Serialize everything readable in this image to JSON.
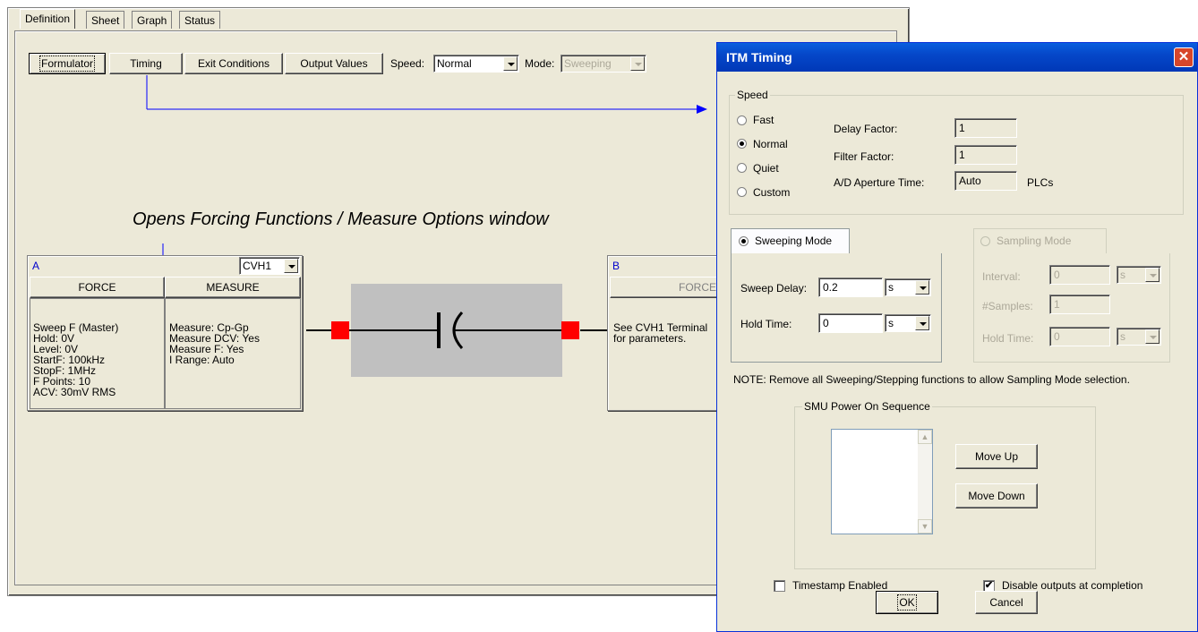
{
  "main": {
    "tabs": [
      "Definition",
      "Sheet",
      "Graph",
      "Status"
    ],
    "toolbar": {
      "formulator": "Formulator",
      "timing": "Timing",
      "exit_conditions": "Exit Conditions",
      "output_values": "Output Values",
      "speed_label": "Speed:",
      "speed_value": "Normal",
      "mode_label": "Mode:",
      "mode_value": "Sweeping"
    },
    "annotation": "Opens Forcing Functions / Measure Options window",
    "terminal_a": {
      "letter": "A",
      "select": "CVH1",
      "force_header": "FORCE",
      "measure_header": "MEASURE",
      "force_lines": [
        "Sweep F (Master)",
        "Hold: 0V",
        "Level: 0V",
        "StartF: 100kHz",
        "StopF: 1MHz",
        "F Points: 10",
        "ACV: 30mV RMS"
      ],
      "measure_lines": [
        "Measure: Cp-Gp",
        "Measure DCV: Yes",
        "Measure F: Yes",
        "I Range: Auto"
      ]
    },
    "terminal_b": {
      "letter": "B",
      "force_header": "FORCE",
      "lines": [
        "See CVH1 Terminal",
        "for parameters."
      ]
    },
    "colors": {
      "accent": "#0000ff",
      "terminal": "#ff0000",
      "device": "#c0c0c0"
    }
  },
  "dialog": {
    "title": "ITM Timing",
    "speed_group": "Speed",
    "speed_options": [
      "Fast",
      "Normal",
      "Quiet",
      "Custom"
    ],
    "speed_selected": "Normal",
    "delay_factor_label": "Delay Factor:",
    "delay_factor": "1",
    "filter_factor_label": "Filter Factor:",
    "filter_factor": "1",
    "ad_label": "A/D Aperture Time:",
    "ad_value": "Auto",
    "ad_unit": "PLCs",
    "sweeping_mode": "Sweeping Mode",
    "sweep_delay_label": "Sweep Delay:",
    "sweep_delay": "0.2",
    "sweep_delay_unit": "s",
    "hold_time_label": "Hold Time:",
    "hold_time": "0",
    "hold_time_unit": "s",
    "sampling_mode": "Sampling Mode",
    "interval_label": "Interval:",
    "interval": "0",
    "interval_unit": "s",
    "samples_label": "#Samples:",
    "samples": "1",
    "s_hold_label": "Hold Time:",
    "s_hold": "0",
    "s_hold_unit": "s",
    "note": "NOTE: Remove all Sweeping/Stepping functions to allow Sampling Mode selection.",
    "smu_group": "SMU Power On Sequence",
    "move_up": "Move Up",
    "move_down": "Move Down",
    "timestamp": "Timestamp Enabled",
    "timestamp_checked": false,
    "disable_outputs": "Disable outputs at completion",
    "disable_outputs_checked": true,
    "ok": "OK",
    "cancel": "Cancel"
  }
}
